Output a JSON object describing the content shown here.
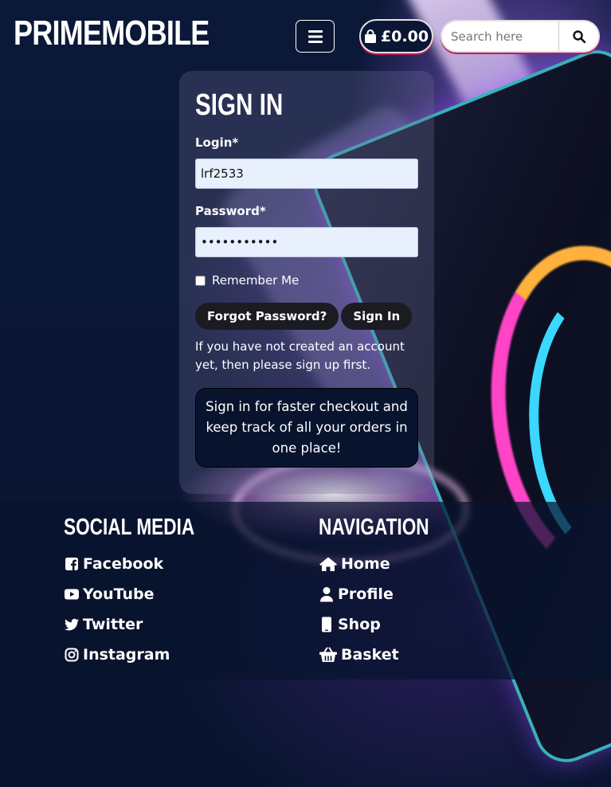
{
  "header": {
    "brand": "PRIMEMOBILE",
    "basket_total": "£0.00",
    "search_placeholder": "Search here"
  },
  "signin": {
    "title": "SIGN IN",
    "login_label": "Login*",
    "login_value": "lrf2533",
    "password_label": "Password*",
    "password_value": "•••••••••••",
    "remember_label": "Remember Me",
    "forgot_label": "Forgot Password?",
    "signin_label": "Sign In",
    "note": "If you have not created an account yet, then please sign up first.",
    "promo": "Sign in for faster checkout and keep track of all your orders in one place!"
  },
  "footer": {
    "social_heading": "SOCIAL MEDIA",
    "social_links": [
      "Facebook",
      "YouTube",
      "Twitter",
      "Instagram"
    ],
    "nav_heading": "NAVIGATION",
    "nav_links": [
      "Home",
      "Profile",
      "Shop",
      "Basket"
    ]
  },
  "colors": {
    "background": "#08142e",
    "accent": "#c2185b",
    "button_dark": "#1b1b22"
  }
}
